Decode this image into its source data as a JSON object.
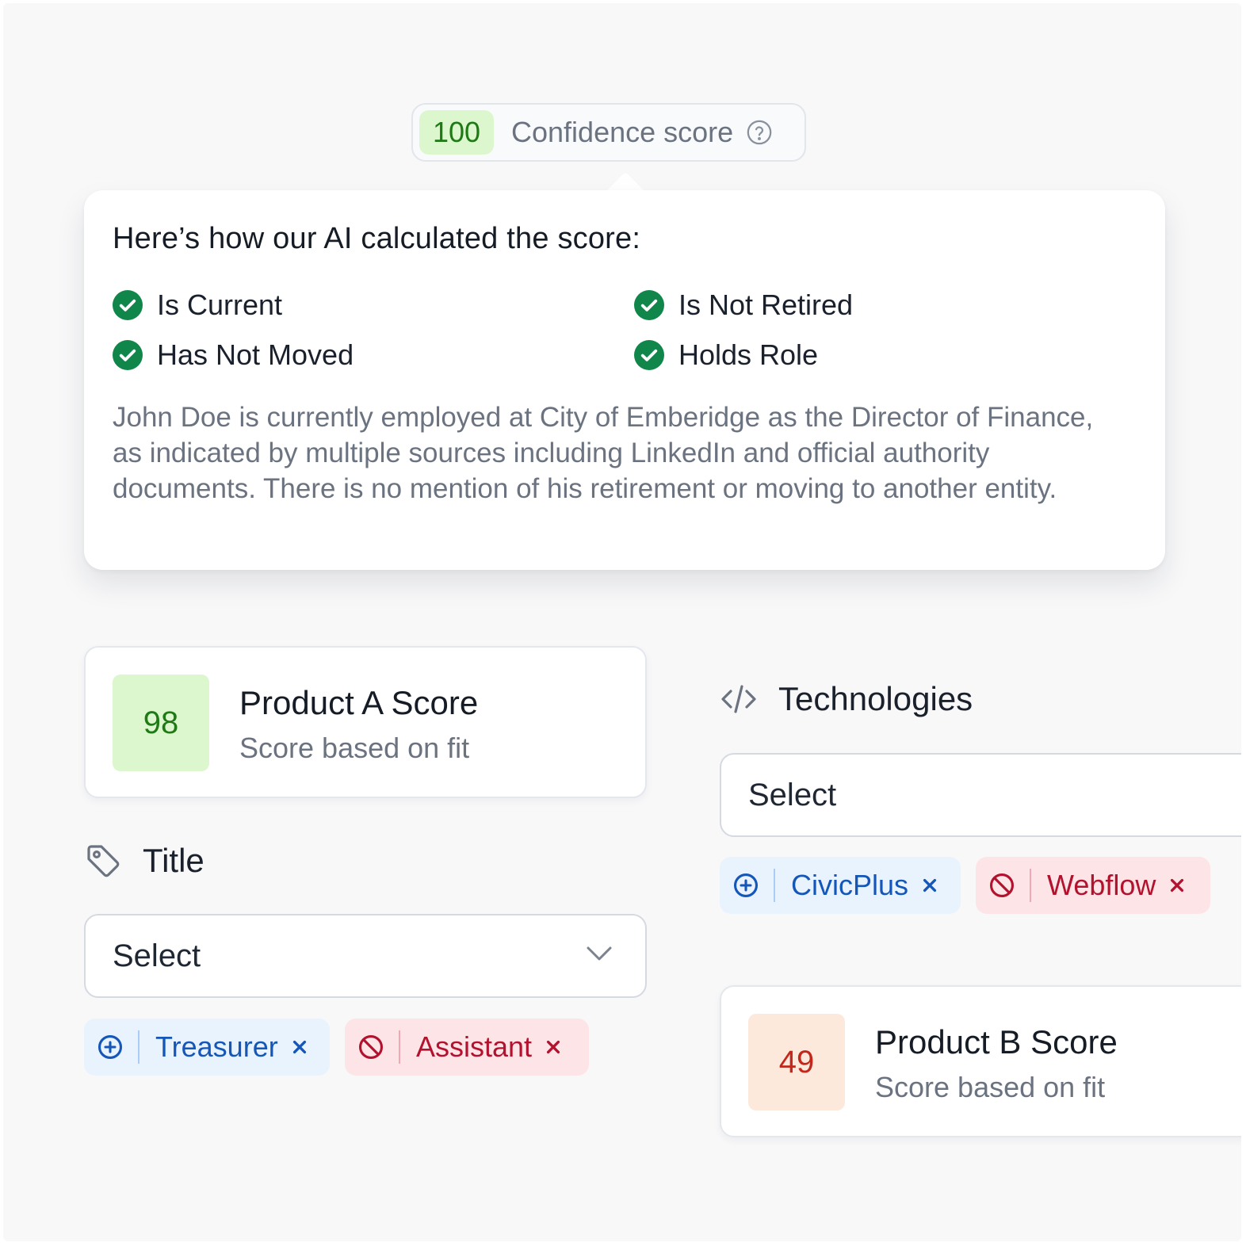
{
  "confidence": {
    "value": "100",
    "label": "Confidence score",
    "help_icon": "question-circle-icon"
  },
  "tooltip": {
    "heading": "Here’s how our AI calculated the score:",
    "checks": [
      {
        "label": "Is Current",
        "icon": "check-circle-icon"
      },
      {
        "label": "Is Not Retired",
        "icon": "check-circle-icon"
      },
      {
        "label": "Has Not Moved",
        "icon": "check-circle-icon"
      },
      {
        "label": "Holds Role",
        "icon": "check-circle-icon"
      }
    ],
    "description": "John Doe is currently employed at City of Emberidge as the Director of Finance, as indicated by multiple sources including LinkedIn and official authority documents. There is no mention of his retirement or moving to another entity."
  },
  "product_a": {
    "score": "98",
    "title": "Product A Score",
    "subtitle": "Score based on fit"
  },
  "title_filter": {
    "label": "Title",
    "icon": "tag-icon",
    "select_value": "Select",
    "chips": [
      {
        "label": "Treasurer",
        "type": "include"
      },
      {
        "label": "Assistant",
        "type": "exclude"
      }
    ]
  },
  "technologies_filter": {
    "label": "Technologies",
    "icon": "code-icon",
    "select_value": "Select",
    "chips": [
      {
        "label": "CivicPlus",
        "type": "include"
      },
      {
        "label": "Webflow",
        "type": "exclude"
      }
    ]
  },
  "product_b": {
    "score": "49",
    "title": "Product B Score",
    "subtitle": "Score based on fit"
  },
  "colors": {
    "check_green": "#10864a",
    "score_high_bg": "#dcf7cd",
    "score_high_text": "#1f7a16",
    "score_mid_bg": "#fde9db",
    "score_mid_text": "#c2271c",
    "include_text": "#1457b8",
    "exclude_text": "#b3122e"
  }
}
